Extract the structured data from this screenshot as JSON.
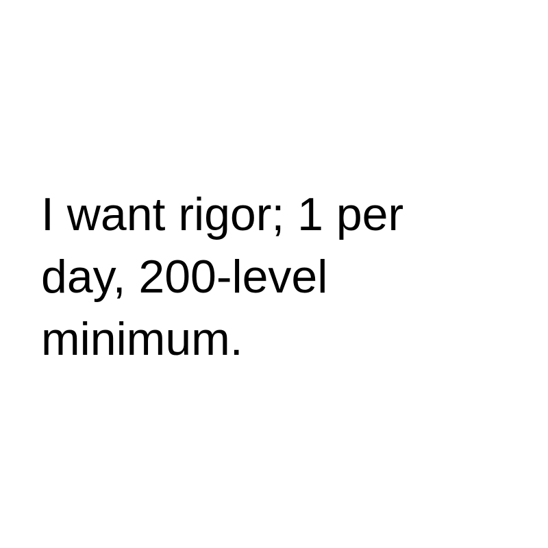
{
  "message": {
    "lines": [
      "I want rigor; 1 per",
      "day, 200-level",
      "minimum."
    ]
  },
  "colors": {
    "background": "#ffffff",
    "text": "#000000"
  }
}
